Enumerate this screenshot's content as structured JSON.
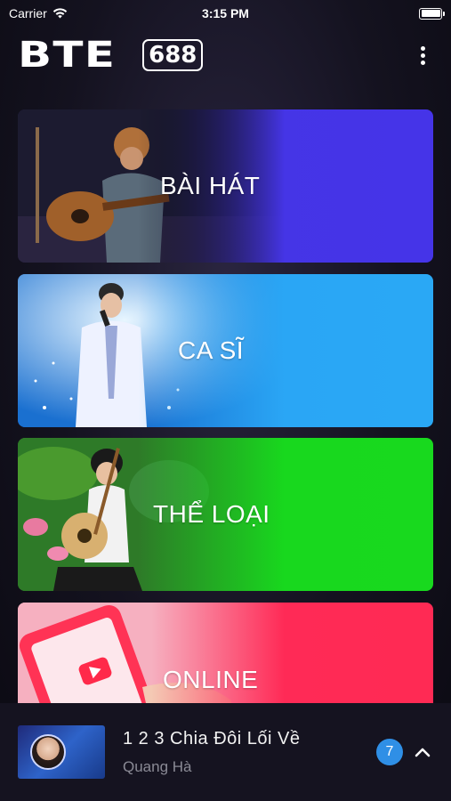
{
  "status_bar": {
    "carrier": "Carrier",
    "time": "3:15 PM"
  },
  "header": {
    "logo_text": "BTE",
    "logo_number": "688",
    "more_icon": "more-vertical-icon"
  },
  "categories": [
    {
      "label": "BÀI HÁT",
      "art": "guitarist-photo",
      "color": "#4535e6"
    },
    {
      "label": "CA SĨ",
      "art": "singer-photo",
      "color": "#2aa6f5"
    },
    {
      "label": "THỂ LOẠI",
      "art": "traditional-musician-photo",
      "color": "#18d81e"
    },
    {
      "label": "ONLINE",
      "art": "phone-youtube-photo",
      "color": "#ff2a56"
    }
  ],
  "now_playing": {
    "title": "1 2 3 Chia Đôi Lối Về",
    "artist": "Quang Hà",
    "queue_count": "7",
    "expand_icon": "chevron-up-icon"
  }
}
